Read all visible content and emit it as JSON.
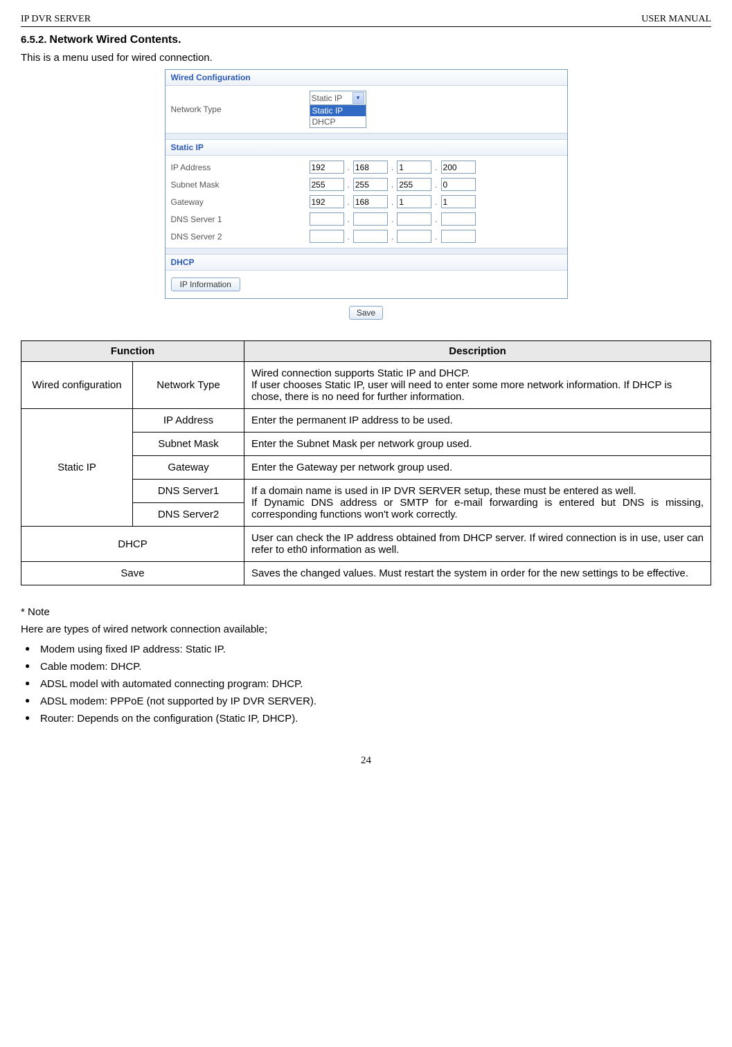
{
  "header": {
    "left": "IP DVR SERVER",
    "right": "USER MANUAL"
  },
  "section": {
    "num": "6.5.2.",
    "title": "Network Wired Contents."
  },
  "intro": "This is a menu used for wired connection.",
  "screenshot": {
    "panel1": {
      "title": "Wired Configuration",
      "row_label": "Network Type",
      "select_value": "Static IP",
      "opt_sel": "Static IP",
      "opt2": "DHCP"
    },
    "panel2": {
      "title": "Static IP",
      "rows": {
        "ip": {
          "label": "IP Address",
          "a": "192",
          "b": "168",
          "c": "1",
          "d": "200"
        },
        "mask": {
          "label": "Subnet Mask",
          "a": "255",
          "b": "255",
          "c": "255",
          "d": "0"
        },
        "gw": {
          "label": "Gateway",
          "a": "192",
          "b": "168",
          "c": "1",
          "d": "1"
        },
        "dns1": {
          "label": "DNS Server 1",
          "a": "",
          "b": "",
          "c": "",
          "d": ""
        },
        "dns2": {
          "label": "DNS Server 2",
          "a": "",
          "b": "",
          "c": "",
          "d": ""
        }
      }
    },
    "panel3": {
      "title": "DHCP",
      "button": "IP Information"
    },
    "save": "Save"
  },
  "table": {
    "head": {
      "func": "Function",
      "desc": "Description"
    },
    "r1": {
      "c1": "Wired configuration",
      "c2": "Network Type",
      "c3": "Wired connection supports Static IP and DHCP.\nIf user chooses Static IP, user will need to enter some more network information. If DHCP is chose, there is no need for further information."
    },
    "r2": {
      "c1": "Static IP",
      "c2": "IP Address",
      "c3": "Enter the permanent IP address to be used."
    },
    "r3": {
      "c2": "Subnet Mask",
      "c3": "Enter the Subnet Mask per network group used."
    },
    "r4": {
      "c2": "Gateway",
      "c3": "Enter the Gateway per network group used."
    },
    "r5": {
      "c2": "DNS Server1"
    },
    "r6": {
      "c2": "DNS Server2",
      "c3": "If a domain name is used in IP DVR SERVER setup, these must be entered as well.\nIf Dynamic DNS address or SMTP for e-mail forwarding is entered but DNS is missing, corresponding functions won't work correctly."
    },
    "r7": {
      "c1": "DHCP",
      "c3": "User can check the IP address obtained from DHCP server. If wired connection is in use, user can refer to eth0 information as well."
    },
    "r8": {
      "c1": "Save",
      "c3": "Saves the changed values. Must restart the system in order for the new settings to be effective."
    }
  },
  "notes": {
    "title": "* Note",
    "intro": "Here are types of wired network connection available;",
    "items": {
      "0": "Modem using fixed IP address: Static IP.",
      "1": "Cable modem: DHCP.",
      "2": "ADSL model with automated connecting program: DHCP.",
      "3": "ADSL modem: PPPoE (not supported by IP DVR SERVER).",
      "4": "Router: Depends on the configuration (Static IP, DHCP)."
    }
  },
  "page": "24"
}
